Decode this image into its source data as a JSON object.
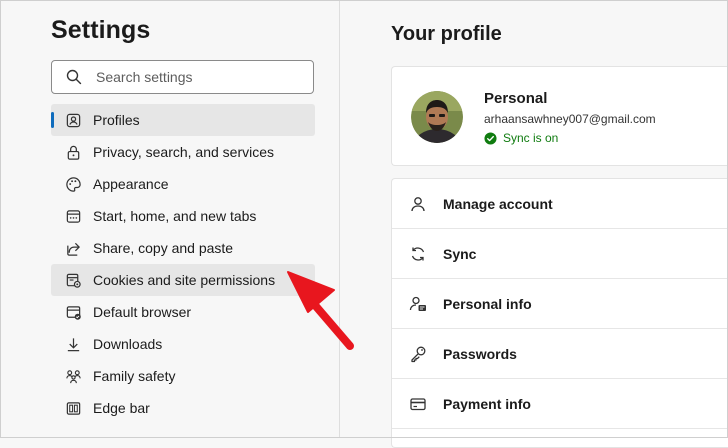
{
  "sidebar": {
    "title": "Settings",
    "search": {
      "placeholder": "Search settings",
      "icon": "search-icon"
    },
    "items": [
      {
        "label": "Profiles",
        "icon": "profiles-icon",
        "state": "selected"
      },
      {
        "label": "Privacy, search, and services",
        "icon": "lock-icon"
      },
      {
        "label": "Appearance",
        "icon": "palette-icon"
      },
      {
        "label": "Start, home, and new tabs",
        "icon": "window-icon"
      },
      {
        "label": "Share, copy and paste",
        "icon": "share-icon"
      },
      {
        "label": "Cookies and site permissions",
        "icon": "cookies-permissions-icon",
        "state": "hovered"
      },
      {
        "label": "Default browser",
        "icon": "browser-icon"
      },
      {
        "label": "Downloads",
        "icon": "download-icon"
      },
      {
        "label": "Family safety",
        "icon": "family-icon"
      },
      {
        "label": "Edge bar",
        "icon": "edge-bar-icon"
      }
    ]
  },
  "main": {
    "title": "Your profile",
    "profile": {
      "name": "Personal",
      "email": "arhaansawhney007@gmail.com",
      "sync_status": "Sync is on"
    },
    "menu": [
      {
        "label": "Manage account",
        "icon": "person-icon"
      },
      {
        "label": "Sync",
        "icon": "sync-icon"
      },
      {
        "label": "Personal info",
        "icon": "personal-info-icon"
      },
      {
        "label": "Passwords",
        "icon": "key-icon"
      },
      {
        "label": "Payment info",
        "icon": "card-icon"
      }
    ]
  },
  "colors": {
    "accent": "#0f6cbd",
    "sync_green": "#107c10",
    "annotation_arrow": "#e8161e"
  }
}
